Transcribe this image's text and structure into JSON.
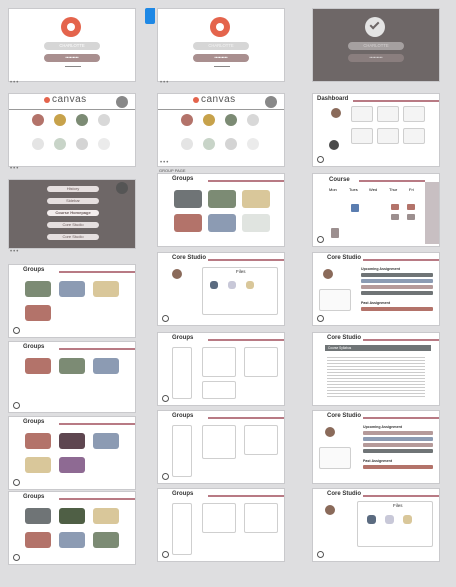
{
  "board_label": "GROUP PAGE",
  "login": {
    "username": "CHARLOTTE",
    "password": "•••••••••"
  },
  "dashboard": {
    "logo_text": "canvas",
    "title": "Dashboard"
  },
  "nav_menu": {
    "items": [
      "History",
      "Sidebar",
      "Course Homepage",
      "Core Studio",
      "Core Studio"
    ]
  },
  "course": {
    "title": "Course",
    "days": [
      "Mon",
      "Tues",
      "Wed",
      "Thur",
      "Fri"
    ]
  },
  "groups": {
    "title": "Groups"
  },
  "core_studio": {
    "title": "Core Studio",
    "files_title": "Files",
    "upcoming": "Upcoming Assignment",
    "past": "Past Assignment",
    "syllabus_tab": "Course Syllabus"
  },
  "colors": {
    "canvas_red": "#e4644c",
    "mauve": "#b87a84",
    "dark_overlay": "#6e6767",
    "tile_grey": "#6f7476",
    "tile_sage": "#7c8b74",
    "tile_sand": "#d9c79a",
    "tile_rust": "#b3736a",
    "tile_blue": "#8c9bb3",
    "tile_plum": "#5e4650",
    "tile_purple": "#8e6a93",
    "accent_blue": "#1e88e5"
  }
}
